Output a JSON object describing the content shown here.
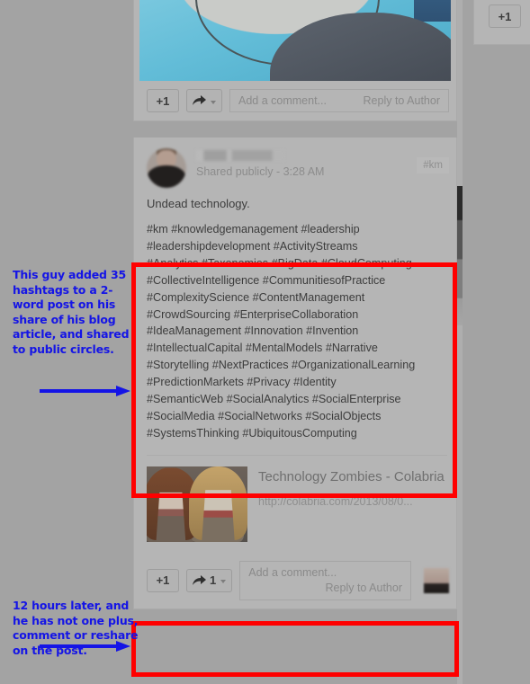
{
  "meta": {
    "app": "Google+ stream",
    "background_color": "#a3a3a3",
    "highlight_color": "#ff0000",
    "annotation_color": "#1414e6"
  },
  "annotations": [
    {
      "id": "top",
      "text": "This guy added 35 hashtags to a 2-word post on his share of his blog article, and shared to public circles."
    },
    {
      "id": "bottom",
      "text": "12 hours later, and he has not one plus, comment or reshare on the post."
    }
  ],
  "top_post": {
    "photo_alt": "Aerial photo of a blue deck with a white circle and a red car",
    "actions": {
      "plus_one_label": "+1",
      "share_icon": "share-arrow-icon",
      "share_caret": "chevron-down-icon",
      "comment_placeholder": "Add a comment...",
      "reply_label": "Reply to Author"
    }
  },
  "main_post": {
    "author_name": "",
    "author_name_redacted": true,
    "visibility": "Shared publicly",
    "separator": "-",
    "time": "3:28 AM",
    "tag_label": "#km",
    "body_text": "Undead technology.",
    "hashtags_block": "#km #knowledgemanagement  #leadership\n#leadershipdevelopment  #ActivityStreams\n #Analytics #Taxonomies #BigData #CloudComputing\n#CollectiveIntelligence #CommunitiesofPractice\n#ComplexityScience #ContentManagement\n#CrowdSourcing  #EnterpriseCollaboration\n#IdeaManagement #Innovation #Invention\n#IntellectualCapital #MentalModels #Narrative\n#Storytelling #NextPractices #OrganizationalLearning\n#PredictionMarkets #Privacy #Identity\n#SemanticWeb #SocialAnalytics #SocialEnterprise\n#SocialMedia #SocialNetworks #SocialObjects\n#SystemsThinking #UbiquitousComputing",
    "hashtag_count": 35,
    "link_preview": {
      "title": "Technology Zombies - Colabria",
      "url": "http://colabria.com/2013/08/0...",
      "thumb_alt": "Two women in zombie makeup"
    },
    "actions": {
      "plus_one_label": "+1",
      "share_icon": "share-arrow-icon",
      "share_count": "1",
      "share_caret": "chevron-down-icon",
      "comment_placeholder": "Add a comment...",
      "reply_label": "Reply to Author",
      "commenter_avatar": "blurred-avatar"
    }
  },
  "right_card": {
    "plus_one_label": "+1"
  },
  "scrollbar": {
    "name": "vertical-scrollbar"
  }
}
